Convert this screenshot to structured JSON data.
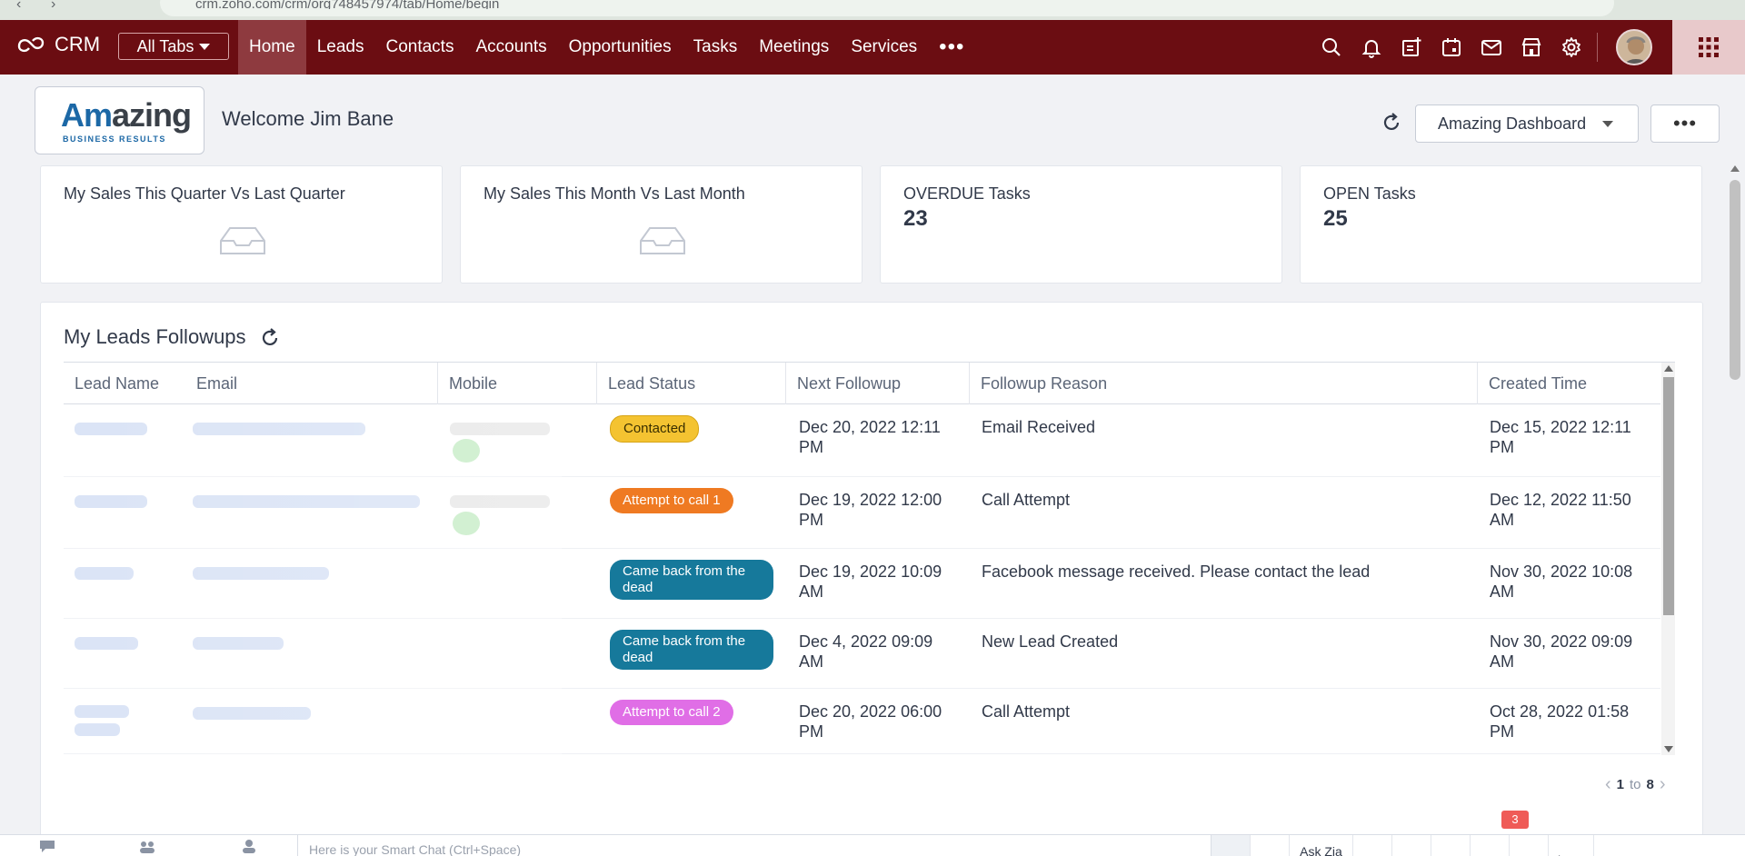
{
  "browser": {
    "url": "crm.zoho.com/crm/org748457974/tab/Home/begin"
  },
  "topnav": {
    "brand": "CRM",
    "all_tabs": "All Tabs",
    "items": [
      "Home",
      "Leads",
      "Contacts",
      "Accounts",
      "Opportunities",
      "Tasks",
      "Meetings",
      "Services"
    ],
    "active": "Home",
    "more": "•••",
    "icons": [
      "search-icon",
      "bell-icon",
      "add-note-icon",
      "calendar-icon",
      "mail-icon",
      "store-icon",
      "gear-icon"
    ]
  },
  "header": {
    "logo_main_a": "Am",
    "logo_main_b": "azing",
    "logo_sub": "BUSINESS RESULTS",
    "welcome": "Welcome Jim Bane",
    "dashboard": "Amazing Dashboard",
    "more": "•••"
  },
  "cards": [
    {
      "title": "My Sales This Quarter Vs Last Quarter",
      "value": ""
    },
    {
      "title": "My Sales This Month Vs Last Month",
      "value": ""
    },
    {
      "title": "OVERDUE Tasks",
      "value": "23"
    },
    {
      "title": "OPEN Tasks",
      "value": "25"
    }
  ],
  "followups": {
    "title": "My Leads Followups",
    "columns": [
      "Lead Name",
      "Email",
      "Mobile",
      "Lead Status",
      "Next Followup",
      "Followup Reason",
      "Created Time"
    ],
    "rows": [
      {
        "status": "Contacted",
        "next_1": "Dec 20, 2022 12:11",
        "next_2": "PM",
        "reason": "Email Received",
        "created_1": "Dec 15, 2022 12:11",
        "created_2": "PM"
      },
      {
        "status": "Attempt to call 1",
        "next_1": "Dec 19, 2022 12:00",
        "next_2": "PM",
        "reason": "Call Attempt",
        "created_1": "Dec 12, 2022 11:50",
        "created_2": "AM"
      },
      {
        "status_1": "Came back from the",
        "status_2": "dead",
        "next_1": "Dec 19, 2022 10:09",
        "next_2": "AM",
        "reason": "Facebook message received. Please contact the lead",
        "created_1": "Nov 30, 2022 10:08",
        "created_2": "AM"
      },
      {
        "status_1": "Came back from the",
        "status_2": "dead",
        "next_1": "Dec 4, 2022 09:09",
        "next_2": "AM",
        "reason": "New Lead Created",
        "created_1": "Nov 30, 2022 09:09",
        "created_2": "AM"
      },
      {
        "status": "Attempt to call 2",
        "next_1": "Dec 20, 2022 06:00",
        "next_2": "PM",
        "reason": "Call Attempt",
        "created_1": "Oct 28, 2022 01:58",
        "created_2": "PM"
      }
    ],
    "pager_from": "1",
    "pager_to_word": "to",
    "pager_to": "8"
  },
  "bottombar": {
    "smart_chat_placeholder": "Here is your Smart Chat (Ctrl+Space)",
    "ask_zia": "Ask Zia",
    "notifications": "3",
    "phone": "Phone"
  },
  "colors": {
    "nav_bg": "#6b0d12",
    "contacted": "#f4c331",
    "attempt_1": "#ef7a22",
    "came_back": "#16799b",
    "attempt_2": "#e06ee6"
  }
}
